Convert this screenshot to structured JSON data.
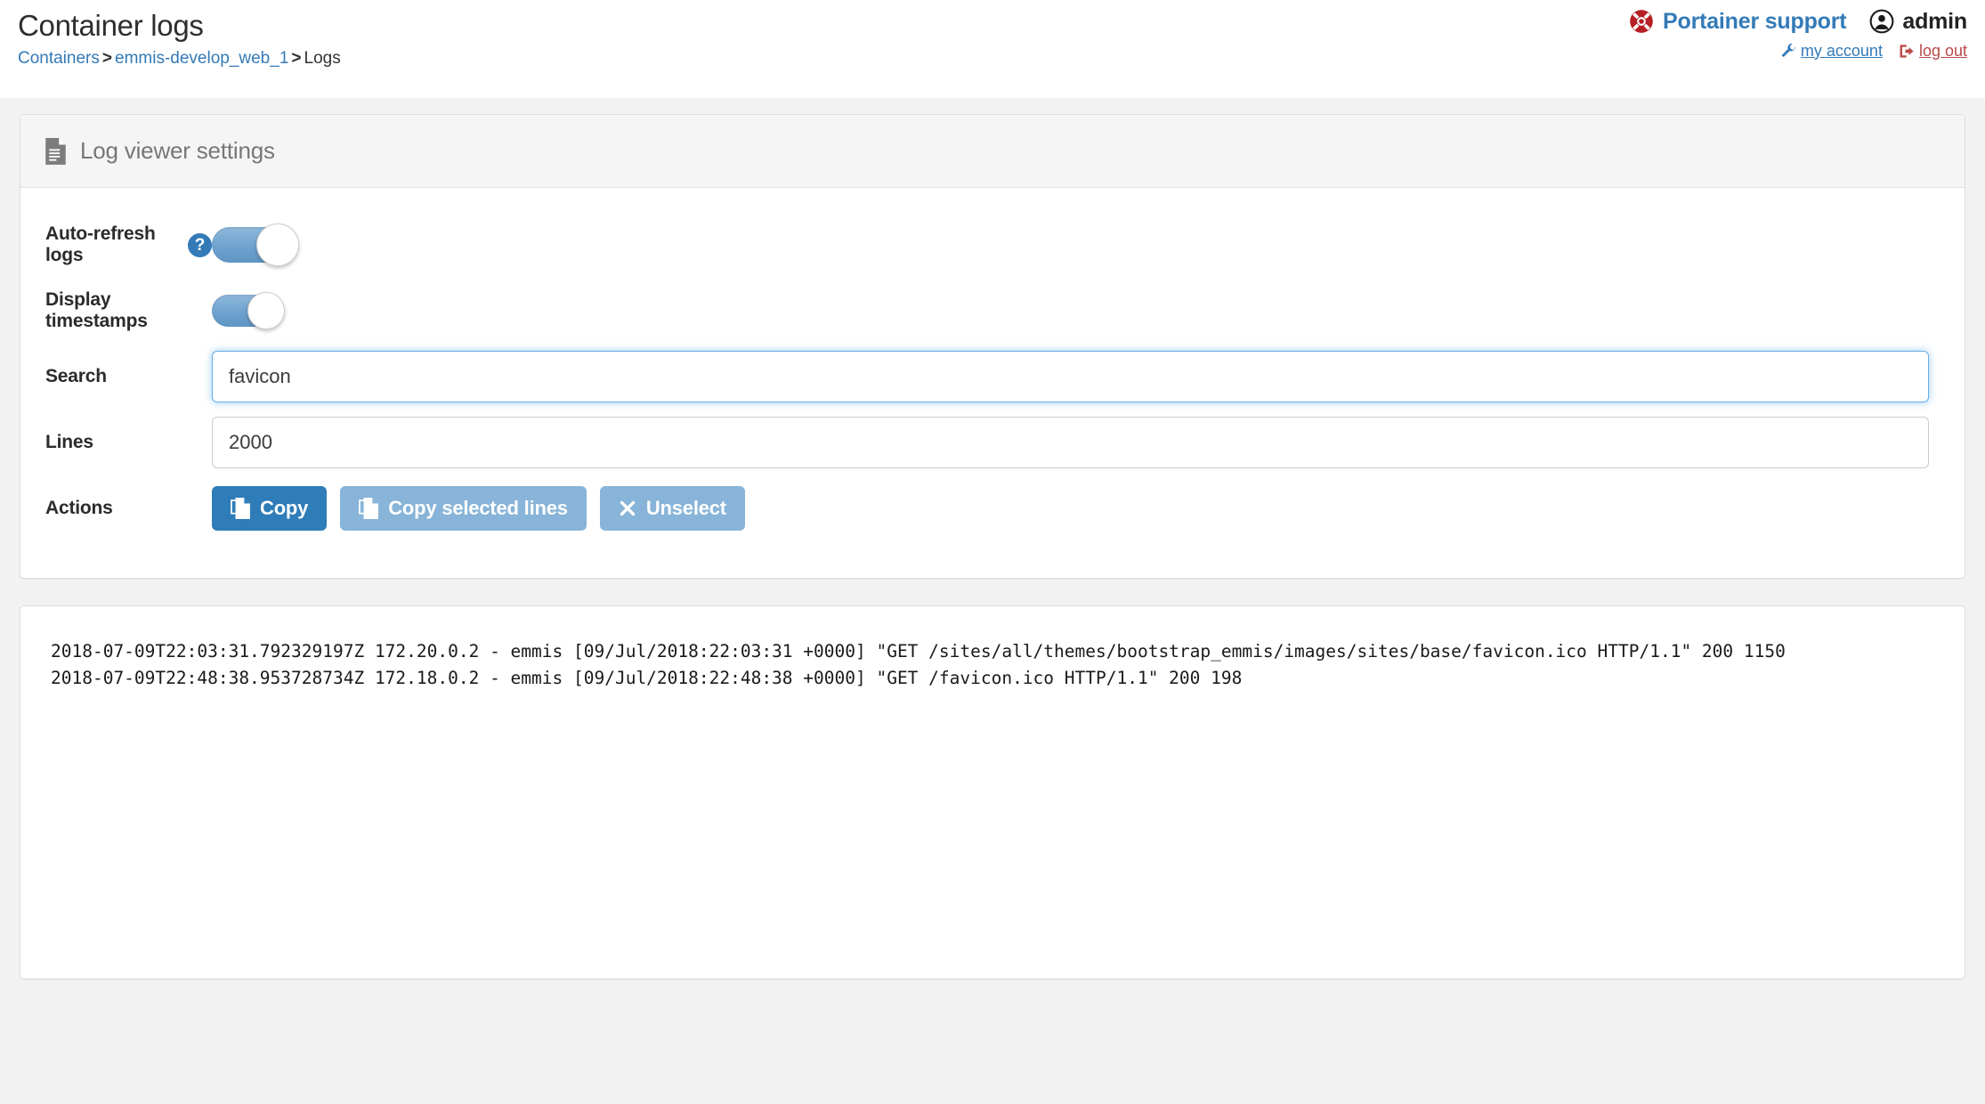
{
  "header": {
    "title": "Container logs",
    "breadcrumb": {
      "items": [
        {
          "label": "Containers",
          "link": true
        },
        {
          "label": "emmis-develop_web_1",
          "link": true
        },
        {
          "label": "Logs",
          "link": false
        }
      ],
      "separator": ">"
    },
    "support_label": "Portainer support",
    "username": "admin",
    "my_account_label": "my account",
    "logout_label": "log out",
    "colors": {
      "link_blue": "#337ab7",
      "logout_red": "#b94a48",
      "support_icon_red": "#b52025"
    }
  },
  "settings_panel": {
    "title": "Log viewer settings",
    "auto_refresh": {
      "label": "Auto-refresh logs",
      "help_icon": "question-circle-icon",
      "state": "on"
    },
    "timestamps": {
      "label": "Display timestamps",
      "state": "on"
    },
    "search": {
      "label": "Search",
      "value": "favicon",
      "placeholder": "",
      "focused": true
    },
    "lines": {
      "label": "Lines",
      "value": "2000",
      "placeholder": ""
    },
    "actions": {
      "label": "Actions",
      "buttons": [
        {
          "label": "Copy",
          "icon": "copy-icon",
          "style": "primary",
          "disabled": false
        },
        {
          "label": "Copy selected lines",
          "icon": "copy-icon",
          "style": "muted",
          "disabled": true
        },
        {
          "label": "Unselect",
          "icon": "close-icon",
          "style": "muted",
          "disabled": true
        }
      ]
    }
  },
  "log_output": {
    "lines": [
      "2018-07-09T22:03:31.792329197Z 172.20.0.2 - emmis [09/Jul/2018:22:03:31 +0000] \"GET /sites/all/themes/bootstrap_emmis/images/sites/base/favicon.ico HTTP/1.1\" 200 1150",
      "2018-07-09T22:48:38.953728734Z 172.18.0.2 - emmis [09/Jul/2018:22:48:38 +0000] \"GET /favicon.ico HTTP/1.1\" 200 198"
    ]
  }
}
